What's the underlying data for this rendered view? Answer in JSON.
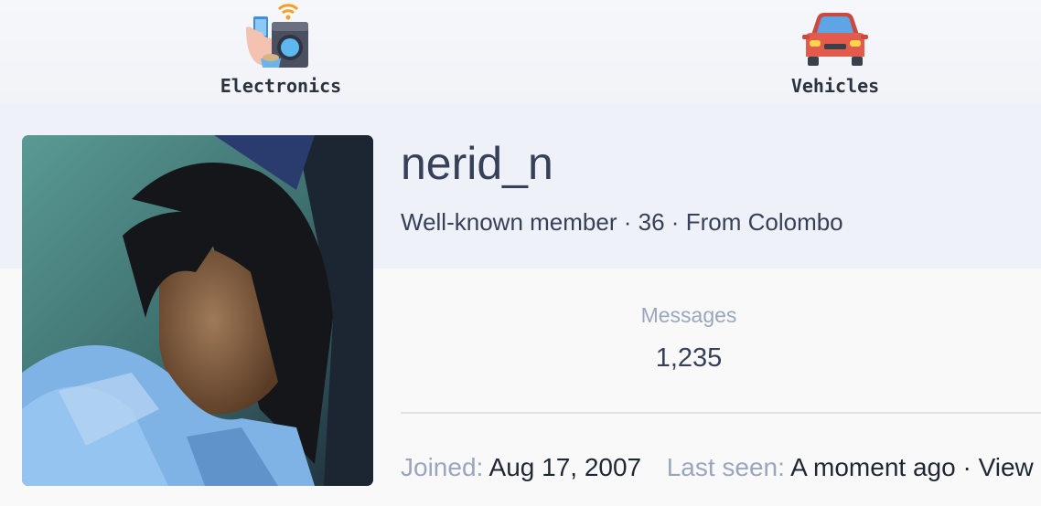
{
  "categories": [
    {
      "label": "Electronics",
      "icon": "electronics-icon"
    },
    {
      "label": "Vehicles",
      "icon": "car-icon"
    }
  ],
  "profile": {
    "username": "nerid_n",
    "title": "Well-known member",
    "age": "36",
    "location_prefix": "From",
    "location": "Colombo",
    "separator": "·",
    "messages_label": "Messages",
    "messages_value": "1,235",
    "joined_label": "Joined:",
    "joined_value": "Aug 17, 2007",
    "last_seen_label": "Last seen:",
    "last_seen_value": "A moment ago",
    "view_link": "View"
  },
  "colors": {
    "heading": "#364058",
    "muted": "#9aa6bd",
    "header_band": "#eef1f8",
    "car_red": "#e25b4d"
  }
}
